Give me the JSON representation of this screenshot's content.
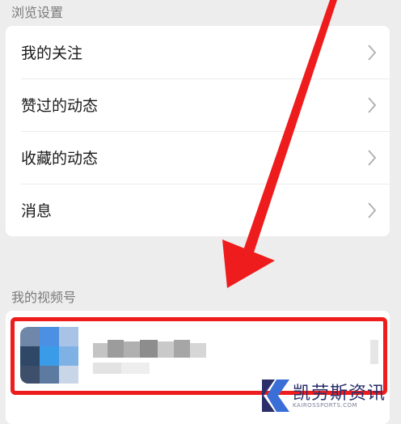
{
  "browse_section": {
    "title": "浏览设置",
    "items": [
      {
        "label": "我的关注"
      },
      {
        "label": "赞过的动态"
      },
      {
        "label": "收藏的动态"
      },
      {
        "label": "消息"
      }
    ]
  },
  "channels_section": {
    "title": "我的视频号"
  },
  "icons": {
    "chevron": "chevron-right-icon",
    "annotation_arrow": "arrow-down-left-icon"
  },
  "colors": {
    "highlight": "#ee1c1c",
    "background": "#ededed",
    "card": "#ffffff",
    "watermark": "#2a2f6a"
  },
  "watermark": {
    "name": "凯劳斯资讯",
    "url": "KAIROSSPORTS.COM"
  }
}
